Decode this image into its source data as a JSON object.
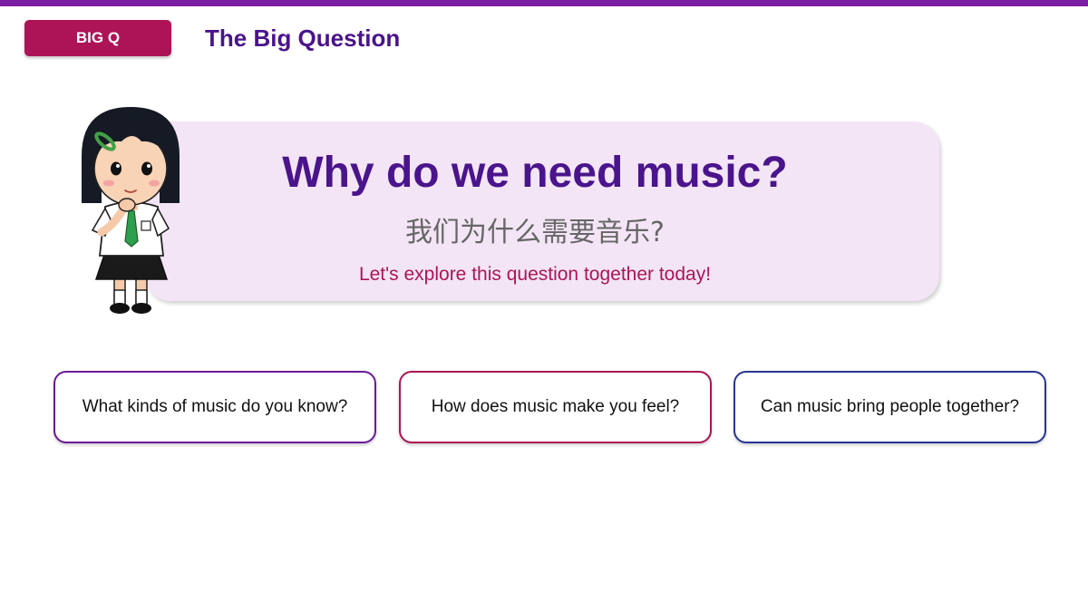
{
  "colors": {
    "top_bar": "#7b1fa2",
    "badge": "#ad1457",
    "header_title": "#4a148c",
    "hero_bg": "#f3e5f5",
    "hero_title": "#4a148c",
    "hero_subtitle": "#666666",
    "hero_tagline": "#ad1457",
    "card1_border": "#6a1b9a",
    "card2_border": "#ad1457",
    "card3_border": "#283593"
  },
  "header": {
    "badge_label": "BIG Q",
    "title": "The Big Question"
  },
  "hero": {
    "title": "Why do we need music?",
    "subtitle": "我们为什么需要音乐?",
    "tagline": "Let's explore this question together today!",
    "illustration": "thinking-girl-icon"
  },
  "questions": [
    {
      "text": "What kinds of music do you know?"
    },
    {
      "text": "How does music make you feel?"
    },
    {
      "text": "Can music bring people together?"
    }
  ]
}
